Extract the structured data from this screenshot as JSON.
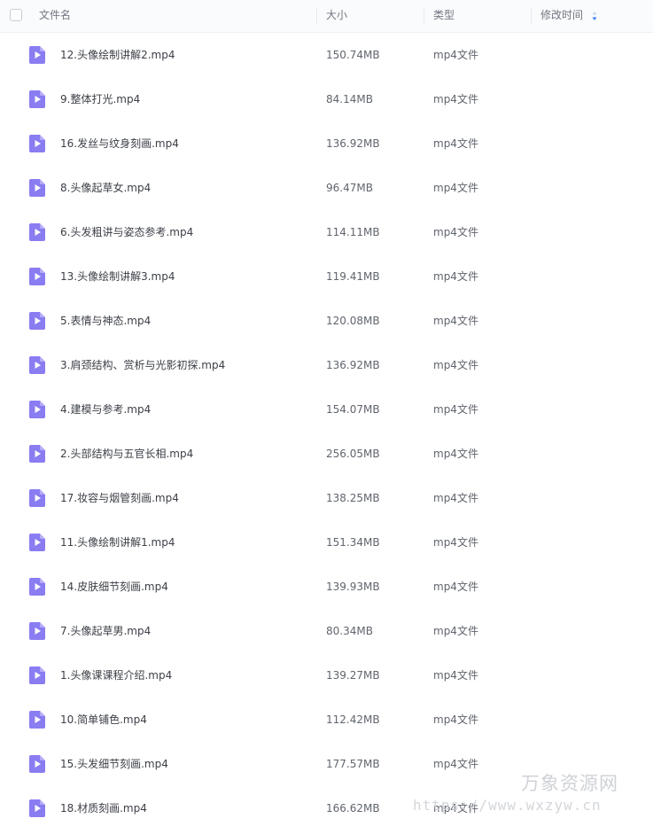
{
  "header": {
    "select_all_label": "",
    "columns": {
      "name": "文件名",
      "size": "大小",
      "type": "类型",
      "modified": "修改时间"
    },
    "sort_icon": "sort-updown-icon"
  },
  "file_icon": "video-play-icon",
  "accent_color": "#8a7cf1",
  "files": [
    {
      "name": "12.头像绘制讲解2.mp4",
      "size": "150.74MB",
      "type": "mp4文件"
    },
    {
      "name": "9.整体打光.mp4",
      "size": "84.14MB",
      "type": "mp4文件"
    },
    {
      "name": "16.发丝与纹身刻画.mp4",
      "size": "136.92MB",
      "type": "mp4文件"
    },
    {
      "name": "8.头像起草女.mp4",
      "size": "96.47MB",
      "type": "mp4文件"
    },
    {
      "name": "6.头发粗讲与姿态参考.mp4",
      "size": "114.11MB",
      "type": "mp4文件"
    },
    {
      "name": "13.头像绘制讲解3.mp4",
      "size": "119.41MB",
      "type": "mp4文件"
    },
    {
      "name": "5.表情与神态.mp4",
      "size": "120.08MB",
      "type": "mp4文件"
    },
    {
      "name": "3.肩颈结构、赏析与光影初探.mp4",
      "size": "136.92MB",
      "type": "mp4文件"
    },
    {
      "name": "4.建模与参考.mp4",
      "size": "154.07MB",
      "type": "mp4文件"
    },
    {
      "name": "2.头部结构与五官长相.mp4",
      "size": "256.05MB",
      "type": "mp4文件"
    },
    {
      "name": "17.妆容与烟管刻画.mp4",
      "size": "138.25MB",
      "type": "mp4文件"
    },
    {
      "name": "11.头像绘制讲解1.mp4",
      "size": "151.34MB",
      "type": "mp4文件"
    },
    {
      "name": "14.皮肤细节刻画.mp4",
      "size": "139.93MB",
      "type": "mp4文件"
    },
    {
      "name": "7.头像起草男.mp4",
      "size": "80.34MB",
      "type": "mp4文件"
    },
    {
      "name": "1.头像课课程介绍.mp4",
      "size": "139.27MB",
      "type": "mp4文件"
    },
    {
      "name": "10.简单铺色.mp4",
      "size": "112.42MB",
      "type": "mp4文件"
    },
    {
      "name": "15.头发细节刻画.mp4",
      "size": "177.57MB",
      "type": "mp4文件"
    },
    {
      "name": "18.材质刻画.mp4",
      "size": "166.62MB",
      "type": "mp4文件"
    }
  ],
  "watermark": {
    "title": "万象资源网",
    "url": "https://www.wxzyw.cn"
  }
}
